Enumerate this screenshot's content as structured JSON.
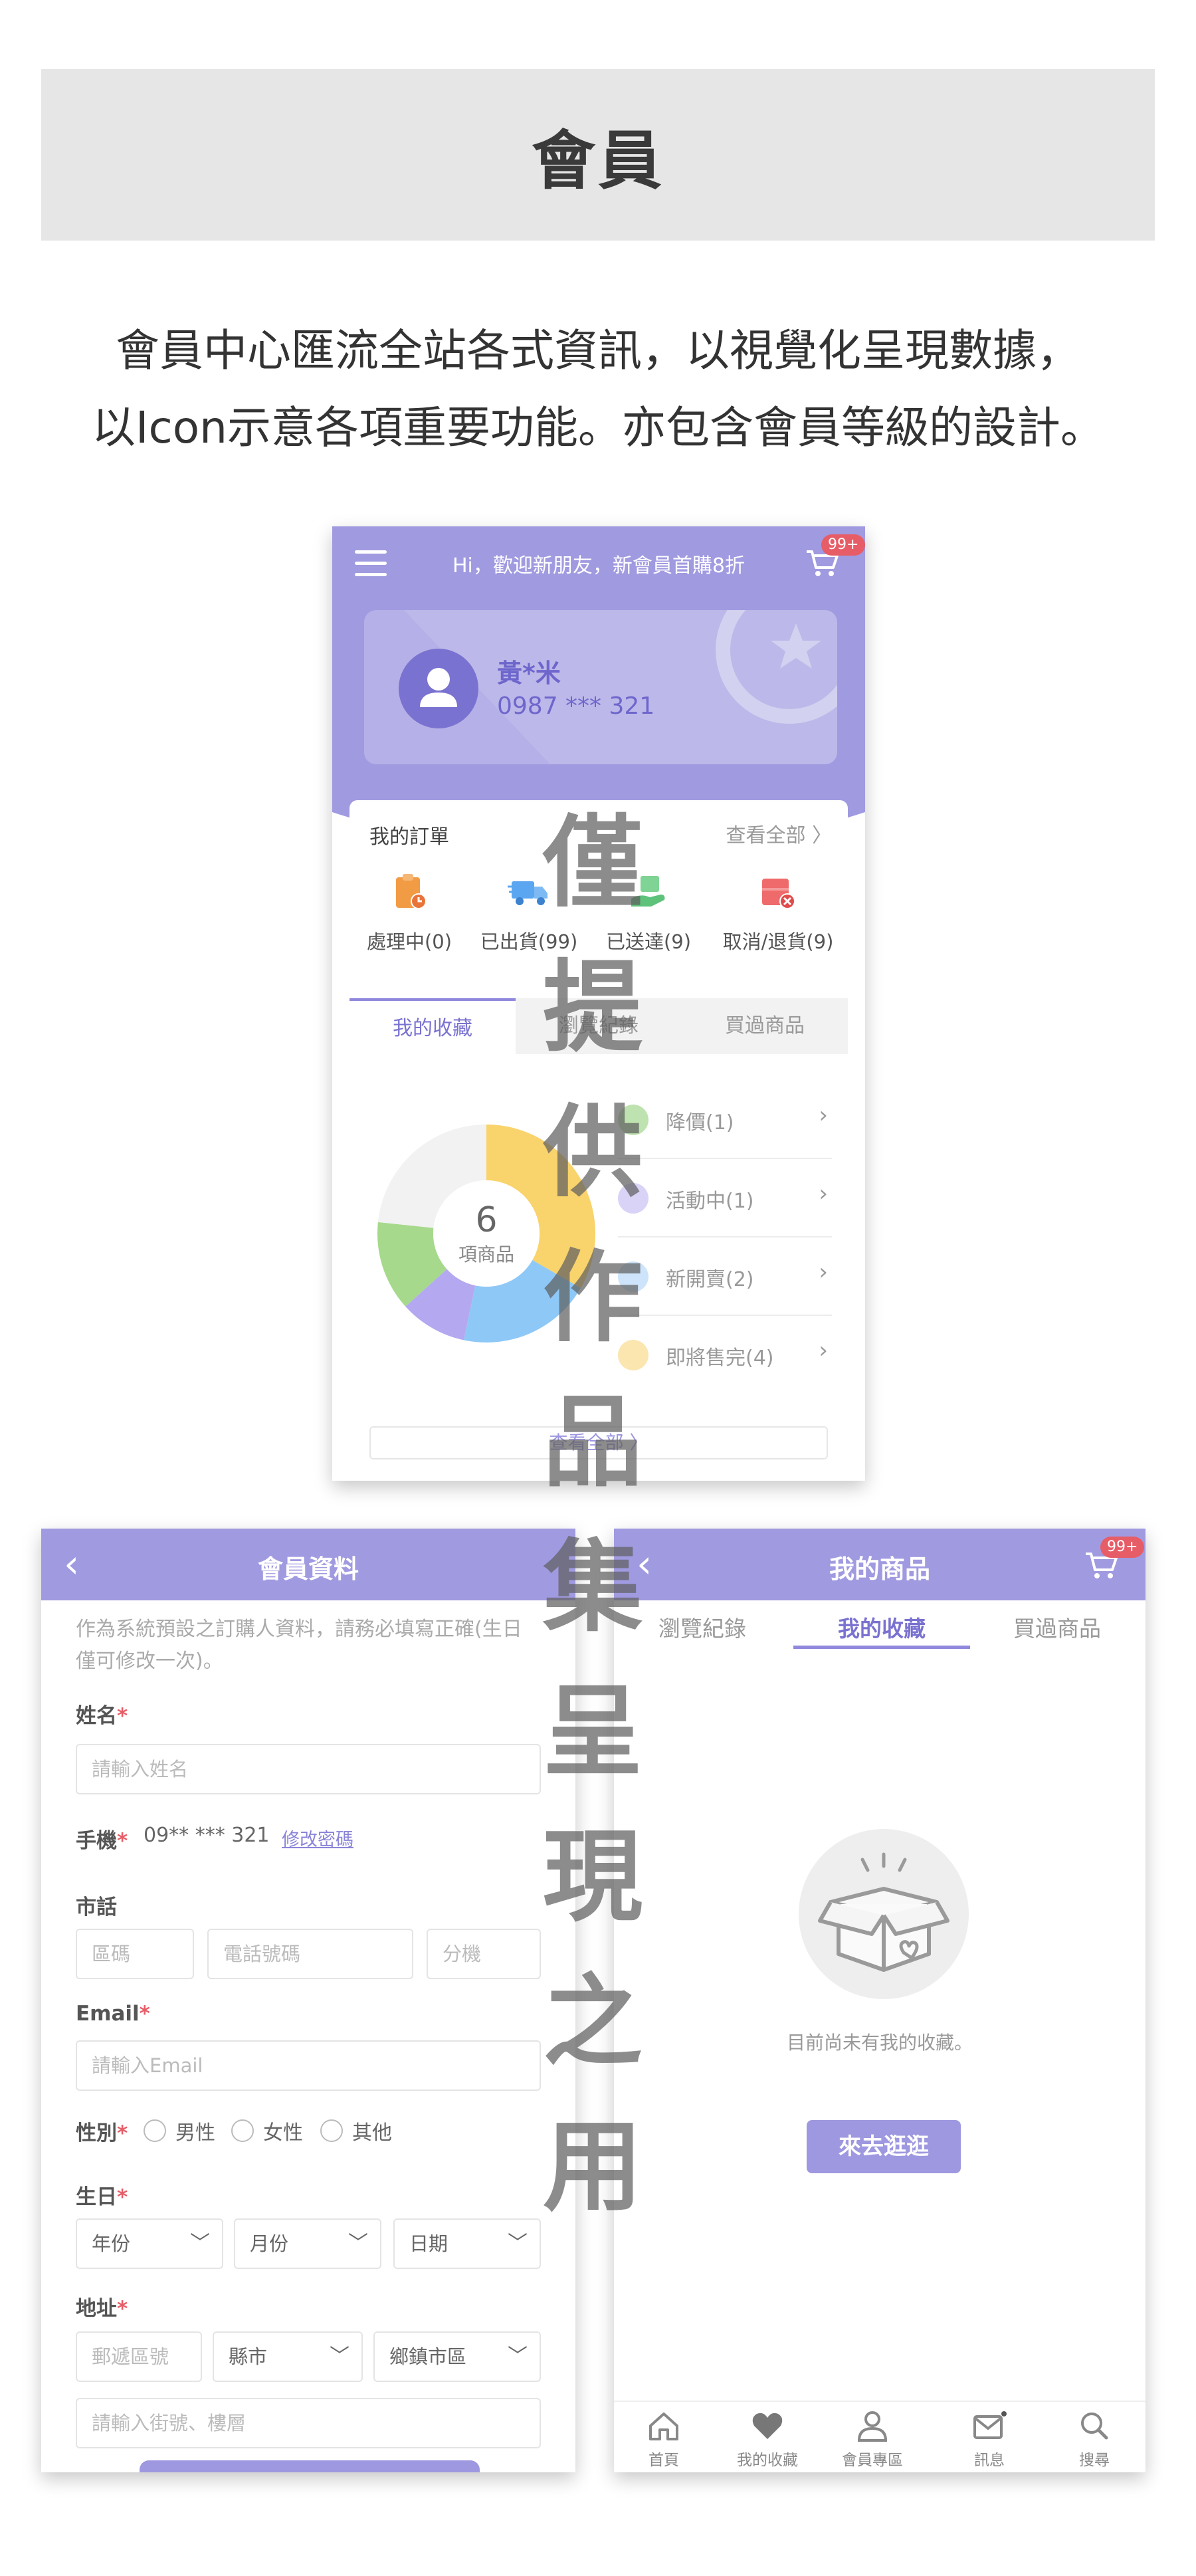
{
  "header": {
    "title": "會員"
  },
  "intro": {
    "line1": "會員中心匯流全站各式資訊，以視覺化呈現數據，",
    "line2": "以Icon示意各項重要功能。亦包含會員等級的設計。"
  },
  "member_center": {
    "greeting": "Hi，歡迎新朋友，新會員首購8折",
    "cart_badge": "99+",
    "user": {
      "name": "黃*米",
      "phone": "0987 *** 321"
    },
    "orders": {
      "title": "我的訂單",
      "view_all": "查看全部 〉",
      "items": [
        {
          "label": "處理中(0)",
          "icon": "clipboard-clock-icon",
          "color": "#f29b45"
        },
        {
          "label": "已出貨(99)",
          "icon": "delivery-truck-icon",
          "color": "#5aa6f0"
        },
        {
          "label": "已送達(9)",
          "icon": "hand-package-icon",
          "color": "#5ec27a"
        },
        {
          "label": "取消/退貨(9)",
          "icon": "cancel-box-icon",
          "color": "#ef6a6a"
        }
      ]
    },
    "tabs": [
      {
        "label": "我的收藏",
        "active": true
      },
      {
        "label": "瀏覽紀錄",
        "active": false
      },
      {
        "label": "買過商品",
        "active": false
      }
    ],
    "donut": {
      "total": "6",
      "unit": "項商品",
      "segments": [
        {
          "value": 2,
          "color": "#f9d36b"
        },
        {
          "value": 1.2,
          "color": "#8ec8f7"
        },
        {
          "value": 0.6,
          "color": "#b4a8f0"
        },
        {
          "value": 0.8,
          "color": "#a6d98c"
        },
        {
          "value": 1.4,
          "color": "#f2f2f2"
        }
      ]
    },
    "favorites": [
      {
        "label": "降價(1)",
        "icon": "price-down-icon",
        "color": "#bfe3b0"
      },
      {
        "label": "活動中(1)",
        "icon": "gift-icon",
        "color": "#d9d3f7"
      },
      {
        "label": "新開賣(2)",
        "icon": "megaphone-icon",
        "color": "#cde4fa"
      },
      {
        "label": "即將售完(4)",
        "icon": "lightning-icon",
        "color": "#fbe6b0"
      }
    ],
    "view_all_button": "查看全部 〉"
  },
  "profile": {
    "title": "會員資料",
    "note": "作為系統預設之訂購人資料，請務必填寫正確(生日僅可修改一次)。",
    "name_label": "姓名",
    "name_placeholder": "請輸入姓名",
    "mobile_label": "手機",
    "mobile_value": "09** *** 321",
    "change_password": "修改密碼",
    "tel_label": "市話",
    "area_placeholder": "區碼",
    "tel_placeholder": "電話號碼",
    "ext_placeholder": "分機",
    "email_label": "Email",
    "email_placeholder": "請輸入Email",
    "gender_label": "性別",
    "gender_options": [
      "男性",
      "女性",
      "其他"
    ],
    "birthday_label": "生日",
    "year": "年份",
    "month": "月份",
    "day": "日期",
    "address_label": "地址",
    "zip_placeholder": "郵遞區號",
    "county": "縣市",
    "district": "鄉鎮市區",
    "street_placeholder": "請輸入街號、樓層",
    "required_mark": "*"
  },
  "my_products": {
    "title": "我的商品",
    "cart_badge": "99+",
    "tabs": [
      {
        "label": "瀏覽紀錄",
        "active": false
      },
      {
        "label": "我的收藏",
        "active": true
      },
      {
        "label": "買過商品",
        "active": false
      }
    ],
    "empty_text": "目前尚未有我的收藏。",
    "go_button": "來去逛逛",
    "bottom_nav": [
      {
        "label": "首頁",
        "icon": "home-icon"
      },
      {
        "label": "我的收藏",
        "icon": "heart-icon"
      },
      {
        "label": "會員專區",
        "icon": "user-icon"
      },
      {
        "label": "訊息",
        "icon": "mail-icon"
      },
      {
        "label": "搜尋",
        "icon": "search-icon"
      }
    ]
  },
  "watermark": {
    "chars": [
      "僅",
      "提",
      "供",
      "作",
      "品",
      "集",
      "呈",
      "現",
      "之",
      "用"
    ]
  },
  "colors": {
    "primary": "#a09ae0",
    "accent": "#7a72d0",
    "badge": "#e75d67"
  }
}
